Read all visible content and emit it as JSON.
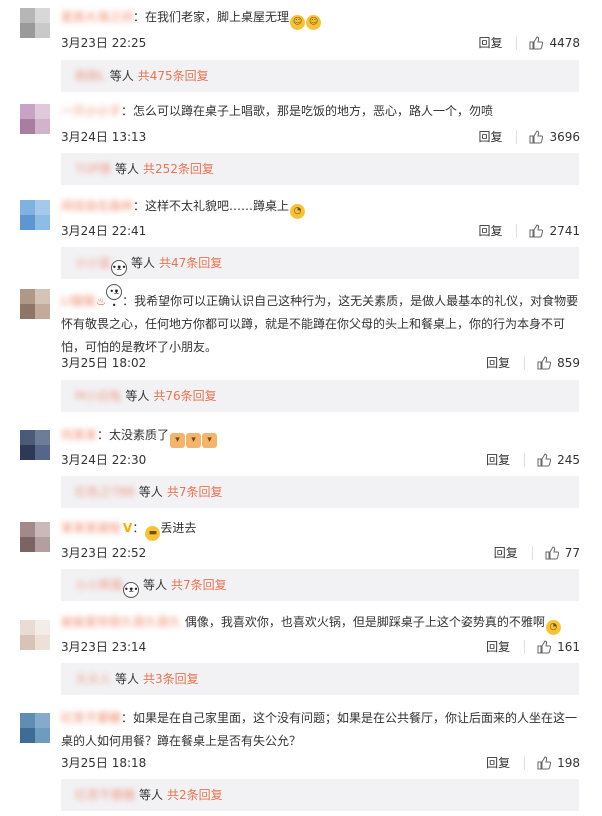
{
  "colors": {
    "accent": "#eb7350",
    "text": "#333333",
    "reply_bg": "#f2f2f5"
  },
  "comments": [
    {
      "user": "星辰大海之间",
      "text": "：在我们老家，脚上桌屋无理",
      "emoji_after": [
        "laugh-emoji",
        "laugh-emoji"
      ],
      "date": "3月23日 22:25",
      "reply_label": "回复",
      "likes": "4478",
      "replies_name": "跑跑L",
      "replies_deng": "等人",
      "replies_count": "共475条回复"
    },
    {
      "user": "一只小小子",
      "text": "：怎么可以蹲在桌子上唱歌，那是吃饭的地方，恶心，路人一个，勿喷",
      "date": "3月24日 13:13",
      "reply_label": "回复",
      "likes": "3696",
      "replies_name": "TOP情",
      "replies_deng": "等人",
      "replies_count": "共252条回复"
    },
    {
      "user": "闲适自在森林",
      "text": "：这样不太礼貌吧……蹲桌上",
      "date": "3月24日 22:41",
      "reply_label": "回复",
      "likes": "2741",
      "replies_name": "小小蓝",
      "replies_deng": "等人",
      "replies_count": "共47条回复"
    },
    {
      "user": "LI猫猫",
      "text": "：我希望你可以正确认识自己这种行为，这无关素质，是做人最基本的礼仪，对食物要怀有敬畏之心，任何地方你都可以蹲，就是不能蹲在你父母的头上和餐桌上，你的行为本身不可怕，可怕的是教坏了小朋友。",
      "date": "3月25日 18:02",
      "reply_label": "回复",
      "likes": "859",
      "replies_name": "M小白兔",
      "replies_deng": "等人",
      "replies_count": "共76条回复"
    },
    {
      "user": "何某某",
      "text": "：太没素质了",
      "date": "3月24日 22:30",
      "reply_label": "回复",
      "likes": "245",
      "replies_name": "红色之TBB",
      "replies_deng": "等人",
      "replies_count": "共7条回复"
    },
    {
      "user": "某某某拔桂",
      "text": "丢进去",
      "date": "3月23日 22:52",
      "reply_label": "回复",
      "likes": "77",
      "replies_name": "小小熊猫",
      "replies_deng": "等人",
      "replies_count": "共7条回复"
    },
    {
      "user": "偷偷爱你很久很久很久",
      "text": "偶像，我喜欢你，也喜欢火锅，但是脚踩桌子上这个姿势真的不雅啊",
      "date": "3月23日 23:14",
      "reply_label": "回复",
      "likes": "161",
      "replies_name": "大大人",
      "replies_deng": "等人",
      "replies_count": "共3条回复"
    },
    {
      "user": "红茶不要糖",
      "text": "：如果是在自己家里面，这个没有问题；如果是在公共餐厅，你让后面来的人坐在这一桌的人如何用餐？蹲在餐桌上是否有失公允？",
      "date": "3月25日 18:18",
      "reply_label": "回复",
      "likes": "198",
      "replies_name": "红茶不要糖",
      "replies_deng": "等人",
      "replies_count": "共2条回复"
    }
  ]
}
